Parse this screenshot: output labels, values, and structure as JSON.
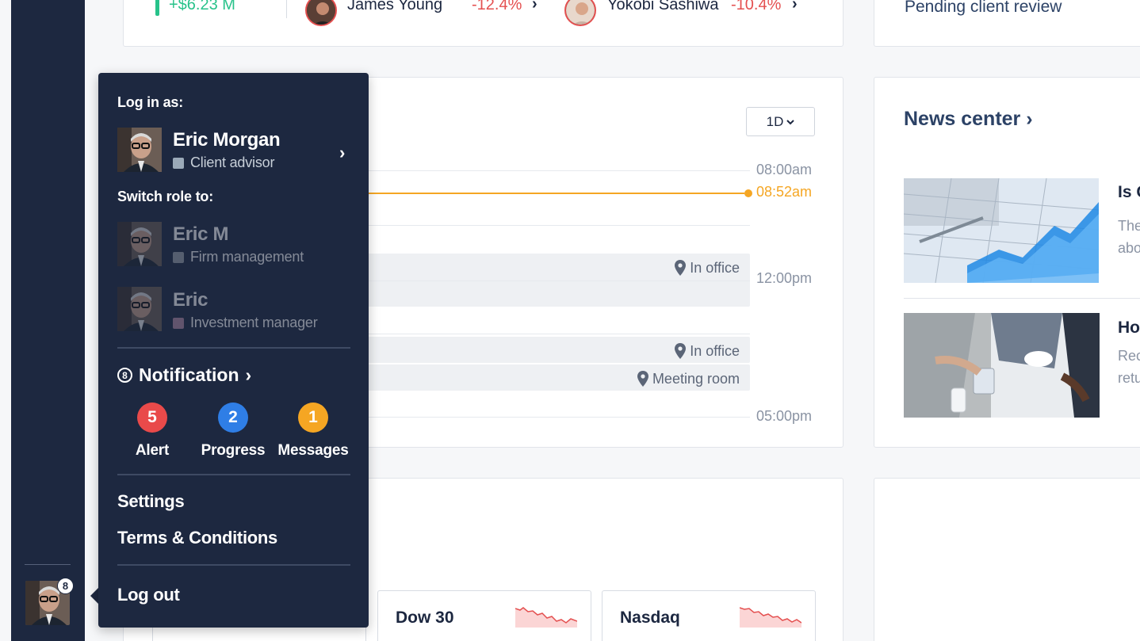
{
  "top_strip": {
    "performance_value": "+$6.23 M",
    "clients": [
      {
        "name": "James Young",
        "change": "-12.4%"
      },
      {
        "name": "Yokobi Sashiwa",
        "change": "-10.4%"
      }
    ],
    "pending_label": "Pending client review"
  },
  "calendar": {
    "range_label": "1D",
    "times": [
      "08:00am",
      "12:00pm",
      "05:00pm"
    ],
    "now_label": "08:52am",
    "events": [
      {
        "location": "In office"
      },
      {
        "location": "In office"
      },
      {
        "location": "Meeting room"
      }
    ]
  },
  "news": {
    "title": "News center",
    "items": [
      {
        "headline": "Is C",
        "text_line1": "The",
        "text_line2": "abo"
      },
      {
        "headline": "Ho",
        "text_line1": "Rec",
        "text_line2": "retu"
      }
    ]
  },
  "indices": [
    {
      "label": "Dow 30"
    },
    {
      "label": "Nasdaq"
    }
  ],
  "sidebar": {
    "notification_count": "8"
  },
  "menu": {
    "login_heading": "Log in as:",
    "current_user": {
      "name": "Eric Morgan",
      "role": "Client advisor"
    },
    "switch_heading": "Switch role to:",
    "roles": [
      {
        "name": "Eric M",
        "role": "Firm management"
      },
      {
        "name": "Eric",
        "role": "Investment manager"
      }
    ],
    "notification_count": "8",
    "notification_label": "Notification",
    "stats": [
      {
        "count": "5",
        "label": "Alert"
      },
      {
        "count": "2",
        "label": "Progress"
      },
      {
        "count": "1",
        "label": "Messages"
      }
    ],
    "settings_label": "Settings",
    "terms_label": "Terms & Conditions",
    "logout_label": "Log out"
  },
  "colors": {
    "sidebar_bg": "#1d2840",
    "positive": "#27c28a",
    "negative": "#e45050",
    "now_marker": "#f5a623",
    "alert": "#e94a4a",
    "progress": "#2f7ee6",
    "messages": "#f5a623",
    "client_advisor": "#9aa9b8",
    "firm_management": "#9aa0a8",
    "investment_manager": "#b48aa4"
  }
}
